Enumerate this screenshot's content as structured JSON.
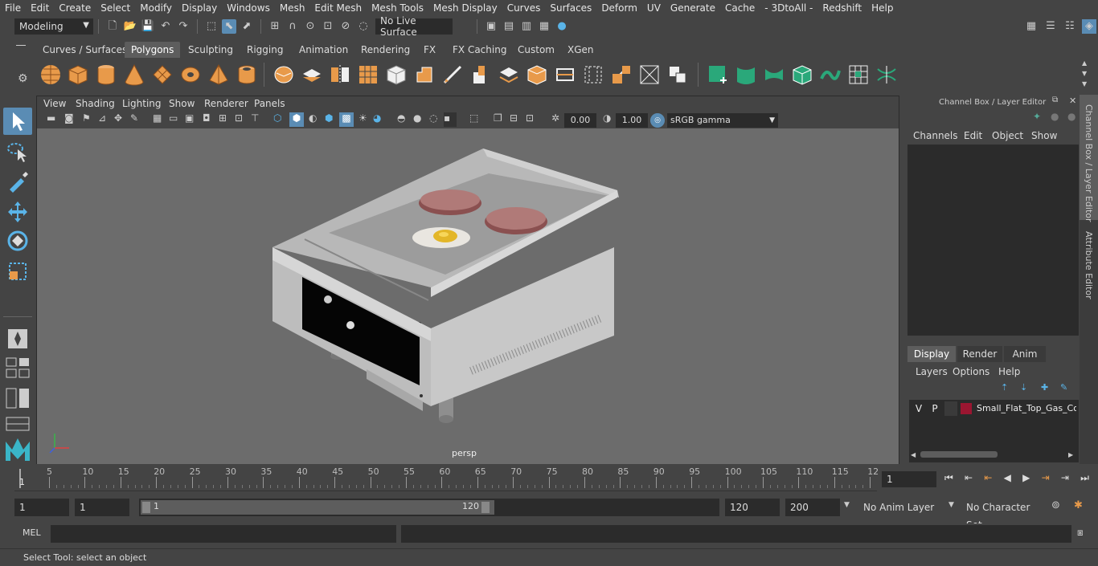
{
  "menubar": [
    "File",
    "Edit",
    "Create",
    "Select",
    "Modify",
    "Display",
    "Windows",
    "Mesh",
    "Edit Mesh",
    "Mesh Tools",
    "Mesh Display",
    "Curves",
    "Surfaces",
    "Deform",
    "UV",
    "Generate",
    "Cache",
    "- 3DtoAll -",
    "Redshift",
    "Help"
  ],
  "status": {
    "mode": "Modeling",
    "live_surface": "No Live Surface"
  },
  "shelf_tabs": [
    "Curves / Surfaces",
    "Polygons",
    "Sculpting",
    "Rigging",
    "Animation",
    "Rendering",
    "FX",
    "FX Caching",
    "Custom",
    "XGen"
  ],
  "active_shelf_tab": "Polygons",
  "viewport": {
    "menu": [
      "View",
      "Shading",
      "Lighting",
      "Show",
      "Renderer",
      "Panels"
    ],
    "exposure": "0.00",
    "gamma": "1.00",
    "color_space": "sRGB gamma",
    "camera_label": "persp"
  },
  "channel_box": {
    "title": "Channel Box / Layer Editor",
    "menu": [
      "Channels",
      "Edit",
      "Object",
      "Show"
    ],
    "tabs": [
      "Display",
      "Render",
      "Anim"
    ],
    "layer_menu": [
      "Layers",
      "Options",
      "Help"
    ],
    "layer": {
      "v": "V",
      "p": "P",
      "name": "Small_Flat_Top_Gas_Cou",
      "color": "#9b1631"
    }
  },
  "side_tabs": [
    "Channel Box / Layer Editor",
    "Attribute Editor"
  ],
  "timeline": {
    "ticks": [
      "5",
      "10",
      "15",
      "20",
      "25",
      "30",
      "35",
      "40",
      "45",
      "50",
      "55",
      "60",
      "65",
      "70",
      "75",
      "80",
      "85",
      "90",
      "95",
      "100",
      "105",
      "110",
      "115",
      "12"
    ],
    "start_marker": "1",
    "current_frame": "1"
  },
  "range": {
    "start": "1",
    "start2": "1",
    "slider_start": "1",
    "slider_end": "120",
    "end": "120",
    "end2": "200",
    "anim_layer": "No Anim Layer",
    "character_set": "No Character Set"
  },
  "mel": {
    "label": "MEL"
  },
  "help_line": "Select Tool: select an object"
}
